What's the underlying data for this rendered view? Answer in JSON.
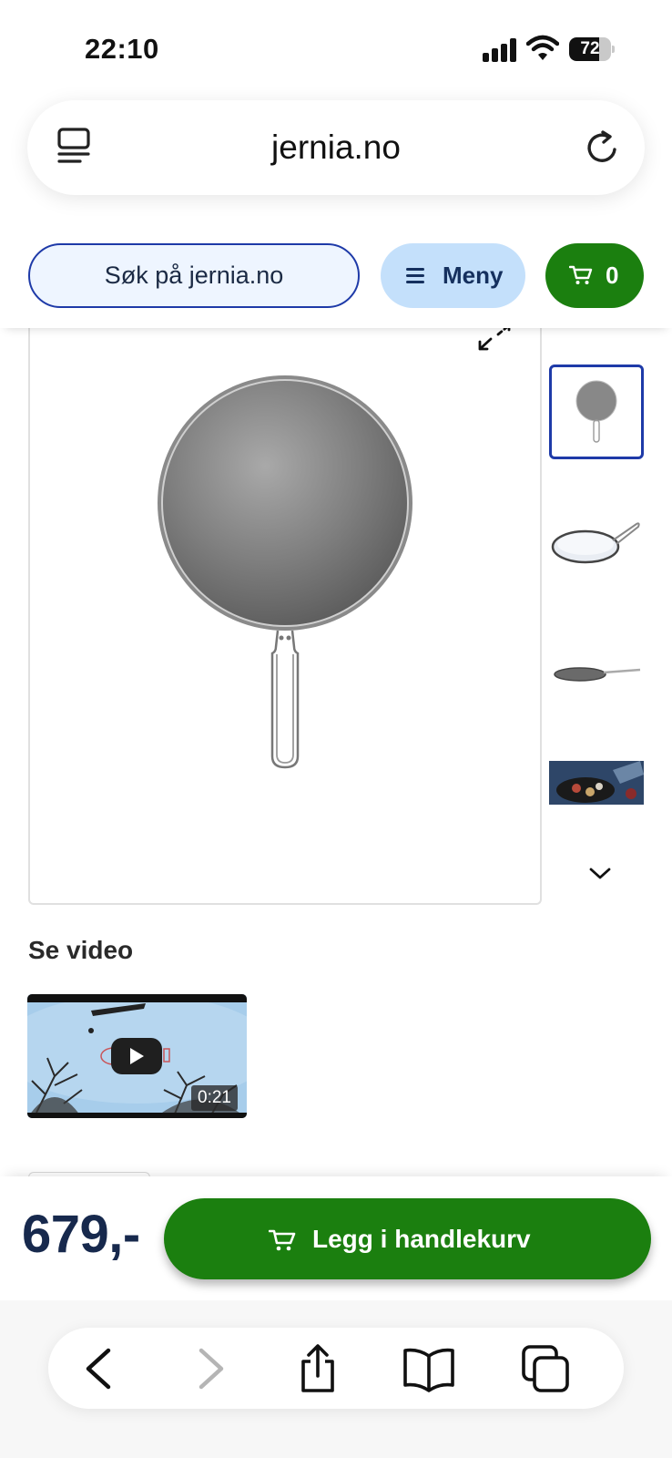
{
  "status_bar": {
    "time": "22:10",
    "battery_level": "72",
    "battery_percent": 72
  },
  "browser": {
    "url": "jernia.no",
    "icons": [
      "tabs-overview-icon",
      "reload-icon"
    ]
  },
  "header": {
    "search_placeholder": "Søk på jernia.no",
    "menu_label": "Meny",
    "cart_count": "0",
    "colors": {
      "accent_blue": "#1e3aa8",
      "menu_bg": "#c4e0fb",
      "cart_green": "#1b7f0f"
    }
  },
  "gallery": {
    "icons": [
      "expand-icon",
      "chevron-down-icon"
    ],
    "thumbnails": [
      {
        "name": "thumb-pan-top-view",
        "active": true
      },
      {
        "name": "thumb-pan-angled"
      },
      {
        "name": "thumb-pan-side"
      },
      {
        "name": "thumb-pan-in-use"
      }
    ]
  },
  "video": {
    "heading": "Se video",
    "duration": "0:21"
  },
  "buy_bar": {
    "price": "679,-",
    "add_to_cart_label": "Legg i handlekurv"
  },
  "toolbar": {
    "buttons": [
      "back-icon",
      "forward-icon",
      "share-icon",
      "bookmarks-icon",
      "tabs-icon"
    ]
  }
}
